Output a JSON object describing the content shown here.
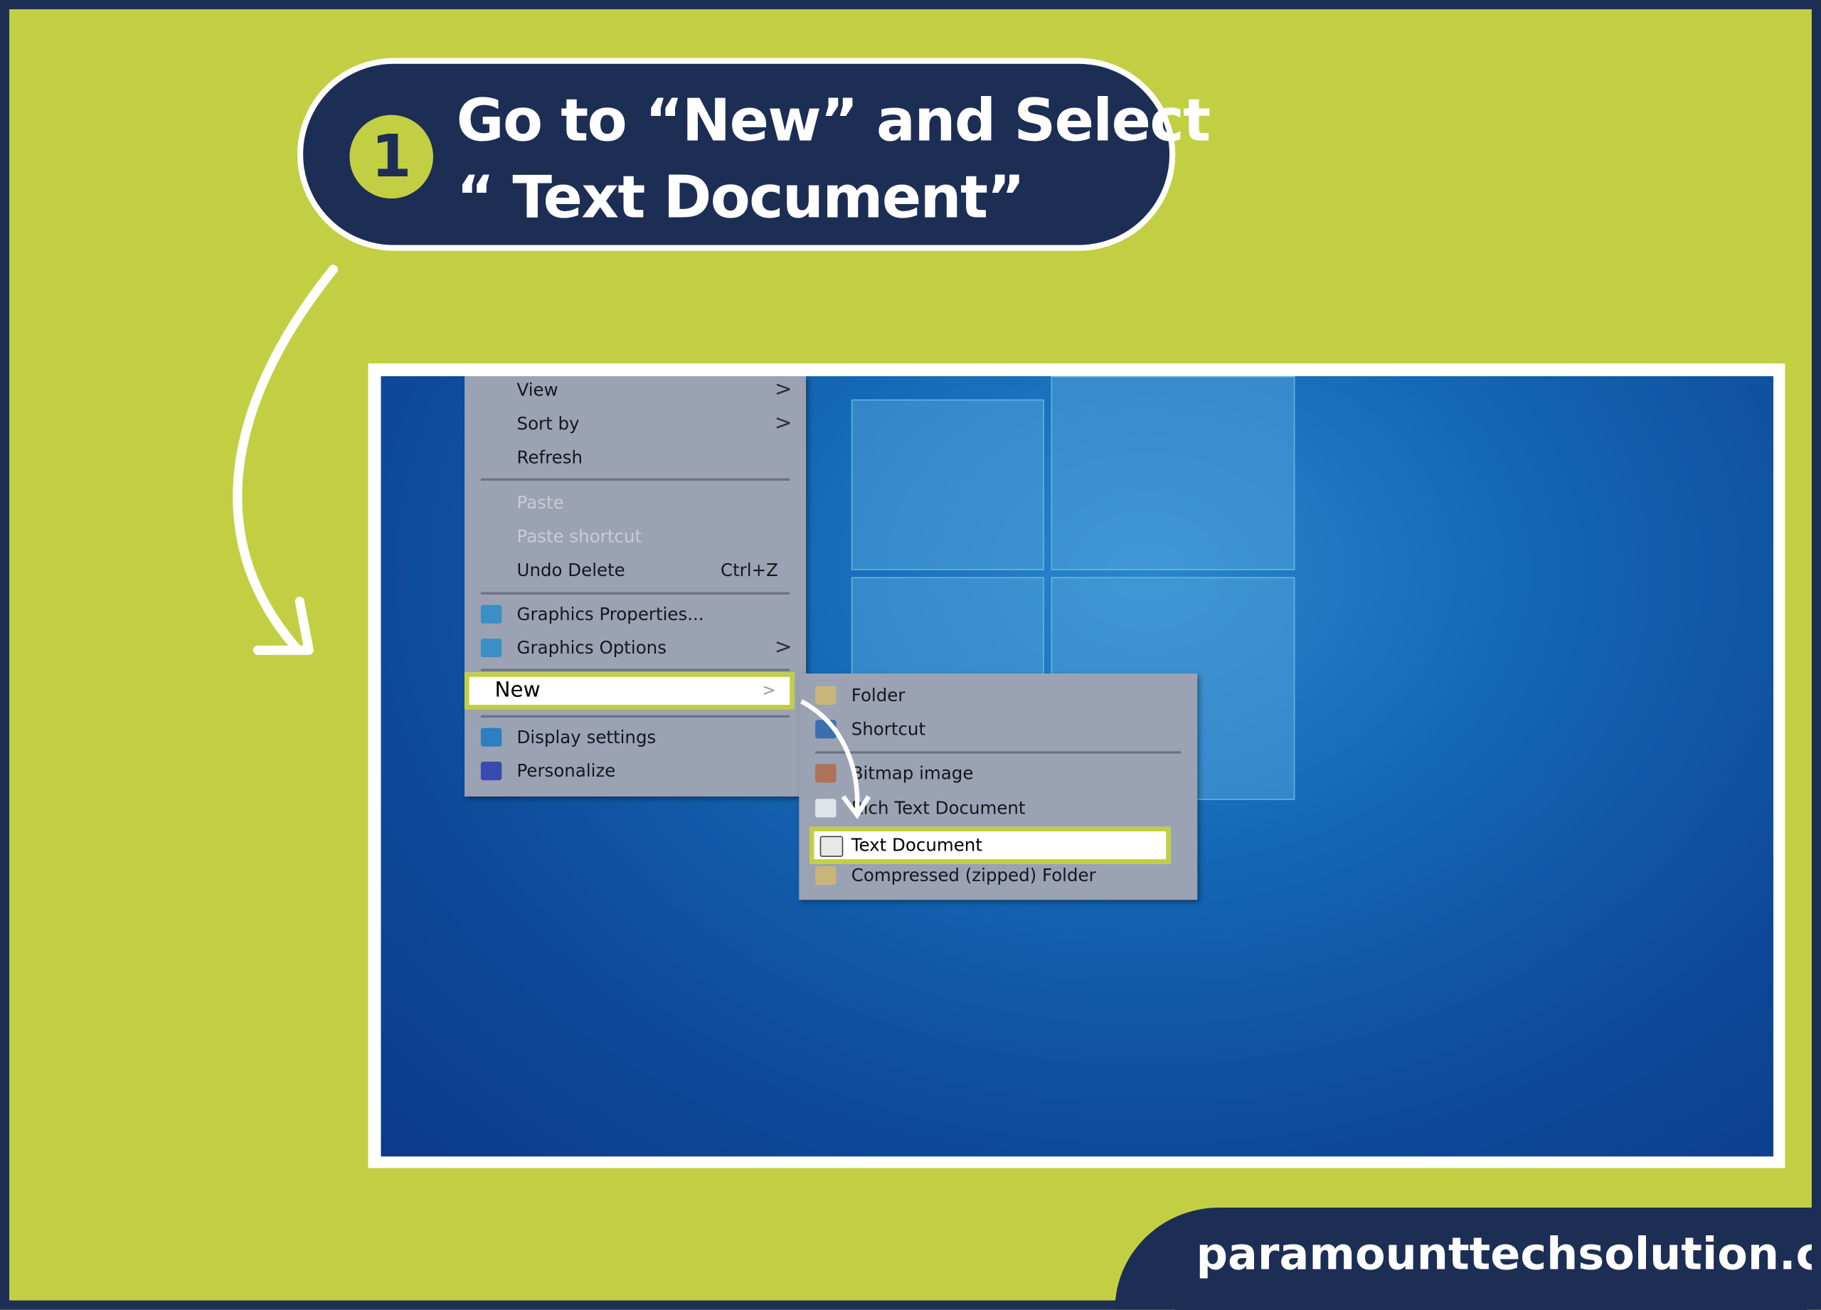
{
  "header": {
    "step_number": "1",
    "title_line1": "Go to “New” and Select",
    "title_line2": "“ Text Document”"
  },
  "context_menu": {
    "items": [
      {
        "label": "View",
        "submenu": true
      },
      {
        "label": "Sort by",
        "submenu": true
      },
      {
        "label": "Refresh"
      },
      {
        "label": "Paste",
        "disabled": true
      },
      {
        "label": "Paste shortcut",
        "disabled": true
      },
      {
        "label": "Undo Delete",
        "shortcut": "Ctrl+Z"
      },
      {
        "label": "Graphics Properties...",
        "icon": "graphics-icon"
      },
      {
        "label": "Graphics Options",
        "icon": "graphics-icon",
        "submenu": true
      },
      {
        "label": "New",
        "submenu": true,
        "highlighted": true
      },
      {
        "label": "Display settings",
        "icon": "display-icon"
      },
      {
        "label": "Personalize",
        "icon": "personalize-icon"
      }
    ]
  },
  "new_submenu": {
    "items": [
      {
        "label": "Folder",
        "icon": "folder-icon"
      },
      {
        "label": "Shortcut",
        "icon": "shortcut-icon"
      },
      {
        "label": "Bitmap image",
        "icon": "bitmap-icon"
      },
      {
        "label": "Rich Text Document",
        "icon": "rtf-icon"
      },
      {
        "label": "Text Document",
        "icon": "text-document-icon",
        "highlighted": true
      },
      {
        "label": "Compressed (zipped) Folder",
        "icon": "zip-folder-icon"
      }
    ]
  },
  "footer": {
    "website": "paramounttechsolution.com"
  },
  "colors": {
    "accent": "#c3cf43",
    "navy": "#1d2e55",
    "menu": "#9aa2b3"
  }
}
